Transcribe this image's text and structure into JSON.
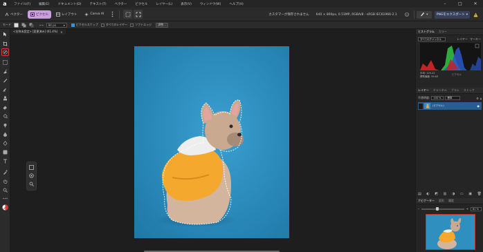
{
  "menubar": {
    "logo_letter": "a",
    "items": [
      "ファイル(F)",
      "編集(E)",
      "ドキュメント(D)",
      "テキスト(T)",
      "ベクター",
      "ピクセル",
      "レイヤー(L)",
      "表示(V)",
      "ウィンドウ(W)",
      "ヘルプ(H)"
    ]
  },
  "toolbar": {
    "personas": [
      {
        "label": "ベクター",
        "active": false
      },
      {
        "label": "ピクセル",
        "active": true
      },
      {
        "label": "レイアウト",
        "active": false
      },
      {
        "label": "Canva AI",
        "active": false
      }
    ],
    "status_unsaved": "カスタマーが保存されません",
    "doc_info": "640 × 800px, 0.51MP, RGBA/8 - sRGB IEC61966-2.1",
    "export_label": "PNGをエクスポート"
  },
  "contextbar": {
    "mode_label": "モード",
    "width_value": "84 px",
    "snapping_label": "ピクセルスナップ",
    "all_layers_label": "すべてのレイヤー",
    "transparency_label": "ソフトエッジ",
    "refine_label": "調整..."
  },
  "document": {
    "tab_title": "<名称未設定> [変更済み] (61.4%)"
  },
  "histogram": {
    "tabs": [
      "ヒストグラム",
      "カラー"
    ],
    "channel": "すべてのチャンネル",
    "sub_tabs": [
      "レイヤー",
      "マーキー"
    ],
    "stats": [
      "平均: 125.22",
      "標準偏差: 59.63"
    ],
    "stats_right": "ピクセル"
  },
  "layers": {
    "tabs": [
      "レイヤー",
      "チャンネル",
      "ブラシ",
      "ストック"
    ],
    "opacity_label": "不透明度:",
    "opacity_value": "100 %",
    "blend_mode": "標準",
    "layer_name": "(ピクセル)"
  },
  "navigator": {
    "tabs": [
      "ナビゲーター",
      "変形",
      "履歴"
    ],
    "zoom_value": "61 %"
  },
  "colors": {
    "accent_persona": "#c9a0dc",
    "selection_highlight": "#e0353c",
    "layer_selected": "#2a5d8f",
    "canvas_background": "#2f8fbf",
    "hoodie": "#f4a92e"
  }
}
